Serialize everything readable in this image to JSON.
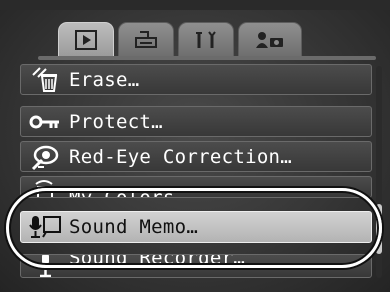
{
  "tabs": [
    {
      "name": "tab-playback",
      "icon": "playback-icon",
      "active": true
    },
    {
      "name": "tab-print",
      "icon": "print-icon",
      "active": false
    },
    {
      "name": "tab-settings",
      "icon": "tools-icon",
      "active": false
    },
    {
      "name": "tab-my-camera",
      "icon": "my-camera-icon",
      "active": false
    }
  ],
  "menu": {
    "items": [
      {
        "label": "Erase…",
        "icon": "erase-icon"
      },
      {
        "label": "Protect…",
        "icon": "protect-key-icon"
      },
      {
        "label": "Red-Eye Correction…",
        "icon": "red-eye-icon"
      },
      {
        "label": "My Colors…",
        "icon": "my-colors-icon"
      },
      {
        "label": "Sound Memo…",
        "icon": "sound-memo-icon",
        "selected": true
      },
      {
        "label": "Sound Recorder…",
        "icon": "sound-recorder-icon"
      }
    ]
  },
  "colors": {
    "selected_item": "#c6c6c6",
    "item_bg": "#424242",
    "highlight_oval": "#ffffff"
  }
}
